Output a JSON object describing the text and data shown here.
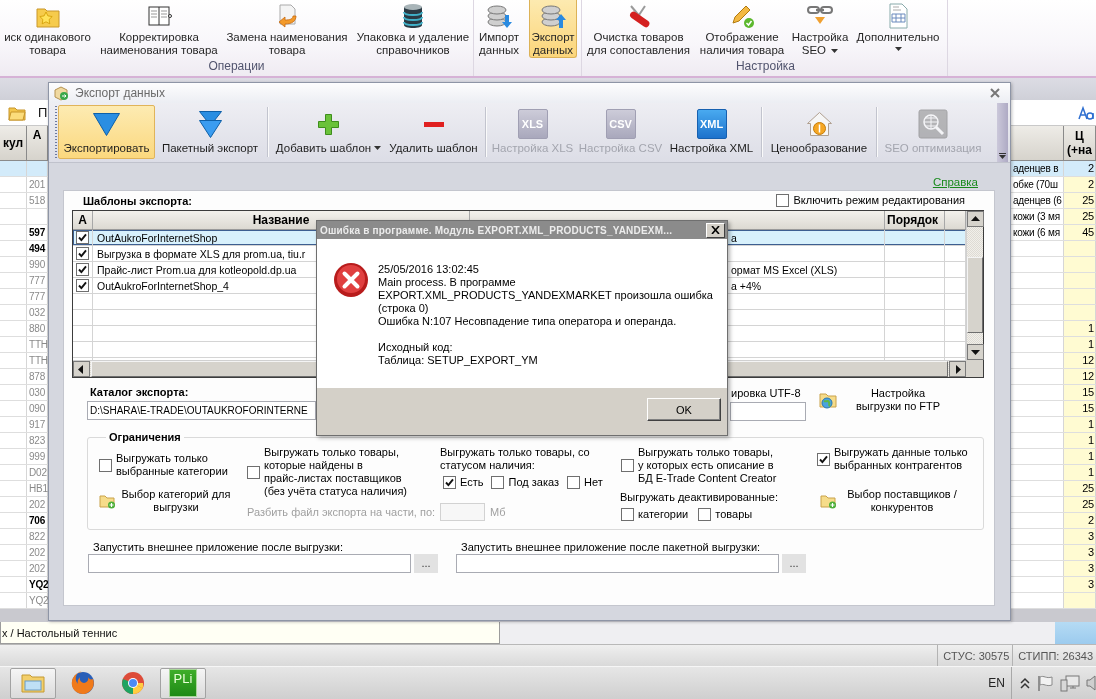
{
  "ribbon": {
    "groups": [
      {
        "label": "Операции",
        "buttons": [
          {
            "lines": [
              "иск одинакового",
              "товара"
            ],
            "selected": false,
            "dropdown": false
          },
          {
            "lines": [
              "Корректировка",
              "наименования товара"
            ],
            "selected": false,
            "dropdown": false
          },
          {
            "lines": [
              "Замена наименования",
              "товара"
            ],
            "selected": false,
            "dropdown": false
          },
          {
            "lines": [
              "Упаковка и удаление",
              "справочников"
            ],
            "selected": false,
            "dropdown": false
          }
        ]
      },
      {
        "buttons": [
          {
            "lines": [
              "Импорт",
              "данных"
            ],
            "selected": false,
            "dropdown": false
          },
          {
            "lines": [
              "Экспорт",
              "данных"
            ],
            "selected": true,
            "dropdown": false
          }
        ]
      },
      {
        "label": "Настройка",
        "buttons": [
          {
            "lines": [
              "Очистка товаров",
              "для сопоставления"
            ],
            "selected": false,
            "dropdown": false
          },
          {
            "lines": [
              "Отображение",
              "наличия товара"
            ],
            "selected": false,
            "dropdown": false
          },
          {
            "lines": [
              "Настройка",
              "SEO"
            ],
            "selected": false,
            "dropdown": true
          },
          {
            "lines": [
              "Дополнительно"
            ],
            "selected": false,
            "dropdown": true
          }
        ]
      }
    ]
  },
  "main": {
    "toolbar_label": "П",
    "left_table": {
      "column_1": "кул",
      "column_2": "А",
      "rows": [
        {
          "selected": true
        },
        {
          "selected": false,
          "dimmed": true,
          "column_2": "201"
        },
        {
          "selected": false,
          "dimmed": true,
          "column_2": "518"
        },
        {
          "selected": false
        },
        {
          "selected": false,
          "dimmed": false,
          "column_2": "597"
        },
        {
          "selected": false,
          "dimmed": false,
          "column_2": "494"
        },
        {
          "selected": false,
          "dimmed": true,
          "column_2": "990"
        },
        {
          "selected": false,
          "dimmed": true,
          "column_2": "777"
        },
        {
          "selected": false,
          "dimmed": true,
          "column_2": "777"
        },
        {
          "selected": false,
          "dimmed": true,
          "column_2": "032"
        },
        {
          "selected": false,
          "dimmed": true,
          "column_2": "880"
        },
        {
          "selected": false,
          "dimmed": true,
          "column_2": "TTH"
        },
        {
          "selected": false,
          "dimmed": true,
          "column_2": "TTH"
        },
        {
          "selected": false,
          "dimmed": true,
          "column_2": "878"
        },
        {
          "selected": false,
          "dimmed": true,
          "column_2": "030"
        },
        {
          "selected": false,
          "dimmed": true,
          "column_2": "090"
        },
        {
          "selected": false,
          "dimmed": true,
          "column_2": "917"
        },
        {
          "selected": false,
          "dimmed": true,
          "column_2": "823"
        },
        {
          "selected": false,
          "dimmed": true,
          "column_2": "999"
        },
        {
          "selected": false,
          "dimmed": true,
          "column_2": "D02"
        },
        {
          "selected": false,
          "dimmed": true,
          "column_2": "HB1"
        },
        {
          "selected": false,
          "dimmed": true,
          "column_2": "202"
        },
        {
          "selected": false,
          "dimmed": false,
          "column_2": "706"
        },
        {
          "selected": false,
          "dimmed": true,
          "column_2": "822"
        },
        {
          "selected": false,
          "dimmed": true,
          "column_2": "202"
        },
        {
          "selected": false,
          "dimmed": true,
          "column_2": "202"
        },
        {
          "selected": false,
          "dimmed": false,
          "column_2": "YQ2"
        },
        {
          "selected": false,
          "dimmed": true,
          "column_2": "YQ2"
        }
      ]
    },
    "right_table": {
      "column_2": [
        "Ц",
        "(+на"
      ],
      "rows": [
        {
          "selected": true,
          "column_1": "аденцев в",
          "column_2": "2"
        },
        {
          "selected": false,
          "column_1": "обке (70ш",
          "column_2": "2"
        },
        {
          "selected": false,
          "column_1": "аденцев (6",
          "column_2": "25"
        },
        {
          "selected": false,
          "column_1": "кожи (3 мя",
          "column_2": "25"
        },
        {
          "selected": false,
          "column_1": "кожи (6 мя",
          "column_2": "45"
        },
        {
          "selected": false
        },
        {
          "selected": false
        },
        {
          "selected": false
        },
        {
          "selected": false
        },
        {
          "selected": false
        },
        {
          "selected": false,
          "column_2": "1"
        },
        {
          "selected": false,
          "column_2": "1"
        },
        {
          "selected": false,
          "column_2": "12"
        },
        {
          "selected": false,
          "column_2": "12"
        },
        {
          "selected": false,
          "column_2": "15"
        },
        {
          "selected": false,
          "column_2": "15"
        },
        {
          "selected": false,
          "column_2": "1"
        },
        {
          "selected": false,
          "column_2": "1"
        },
        {
          "selected": false,
          "column_2": "1"
        },
        {
          "selected": false,
          "column_2": "1"
        },
        {
          "selected": false,
          "column_2": "25"
        },
        {
          "selected": false,
          "column_2": "25"
        },
        {
          "selected": false,
          "column_2": "2"
        },
        {
          "selected": false,
          "column_2": "3"
        },
        {
          "selected": false,
          "column_2": "3"
        },
        {
          "selected": false,
          "column_2": "3"
        },
        {
          "selected": false,
          "column_2": "3"
        },
        {
          "selected": false
        }
      ]
    },
    "info_text": "х / Настольный теннис",
    "status": [
      "СТУС: 30575",
      "СТИПП: 26343"
    ]
  },
  "export_window": {
    "title": "Экспорт данных",
    "toolbar": [
      {
        "buttons": [
          {
            "label": "Экспортировать",
            "selected": true,
            "disabled": false,
            "dropdown": false
          },
          {
            "label": "Пакетный экспорт",
            "selected": false,
            "disabled": false,
            "dropdown": false
          }
        ]
      },
      {
        "buttons": [
          {
            "label": "Добавить шаблон",
            "selected": false,
            "disabled": false,
            "dropdown": true
          },
          {
            "label": "Удалить шаблон",
            "selected": false,
            "disabled": false,
            "dropdown": false
          }
        ]
      },
      {
        "buttons": [
          {
            "label": "Настройка XLS",
            "badge": "XLS",
            "selected": false,
            "disabled": true,
            "dropdown": false
          },
          {
            "label": "Настройка CSV",
            "badge": "CSV",
            "selected": false,
            "disabled": true,
            "dropdown": false
          },
          {
            "label": "Настройка XML",
            "badge": "XML",
            "selected": false,
            "disabled": false,
            "dropdown": false
          }
        ]
      },
      {
        "buttons": [
          {
            "label": "Ценообразование",
            "selected": false,
            "disabled": false,
            "dropdown": false
          }
        ]
      },
      {
        "buttons": [
          {
            "label": "SEO оптимизация",
            "selected": false,
            "disabled": true,
            "dropdown": false
          }
        ]
      }
    ],
    "help_link": "Справка",
    "templates": {
      "title": "Шаблоны экспорта:",
      "edit_mode": {
        "label": "Включить режим редактирования",
        "checked": false
      },
      "columns": [
        "А",
        "Название",
        "Порядок"
      ],
      "rows": [
        {
          "checked": true,
          "selected": true,
          "name": "OutAukroForInternetShop",
          "column_3": "а"
        },
        {
          "checked": true,
          "selected": false,
          "name": "Выгрузка в формате XLS для prom.ua, tiu.r"
        },
        {
          "checked": true,
          "selected": false,
          "name": "Прайс-лист Prom.ua для kotleopold.dp.ua",
          "column_3": "ормат MS Excel (XLS)"
        },
        {
          "checked": true,
          "selected": false,
          "name": "OutAukroForInternetShop_4",
          "column_3": "а +4%"
        }
      ]
    },
    "catalog": {
      "label": "Каталог экспорта:",
      "value": "D:\\SHARA\\E-TRADE\\OUTAUKROFORINTERNE"
    },
    "encoding_label": "ировка UTF-8",
    "ftp_button": [
      "Настройка",
      "выгрузки по FTP"
    ],
    "restrictions": {
      "title": "Ограничения",
      "categories_only": {
        "lines": [
          "Выгружать только",
          "выбранные категории"
        ],
        "checked": false
      },
      "choose_categories": [
        "Выбор категорий для",
        "выгрузки"
      ],
      "supplier_prices_only": {
        "lines": [
          "Выгружать только товары,",
          "которые найдены в",
          "прайс-листах поставщиков",
          "(без учёта статуса наличия)"
        ],
        "checked": false
      },
      "split": {
        "label": "Разбить файл экспорта на части, по:",
        "unit": "Мб",
        "disabled": true
      },
      "stock_status": {
        "lines": [
          "Выгружать только товары, со",
          "статусом наличия:"
        ],
        "options": [
          {
            "label": "Есть",
            "checked": true
          },
          {
            "label": "Под заказ",
            "checked": false
          },
          {
            "label": "Нет",
            "checked": false
          }
        ]
      },
      "with_description": {
        "lines": [
          "Выгружать только товары,",
          "у которых есть описание в",
          "БД E-Trade Content Creator"
        ],
        "checked": false
      },
      "deactivated": {
        "label": "Выгружать деактивированные:",
        "options": [
          {
            "label": "категории",
            "checked": false
          },
          {
            "label": "товары",
            "checked": false
          }
        ]
      },
      "selected_contractors": {
        "lines": [
          "Выгружать данные только",
          "выбранных контрагентов"
        ],
        "checked": true
      },
      "choose_suppliers": [
        "Выбор поставщиков /",
        "конкурентов"
      ]
    },
    "run_after": [
      {
        "label": "Запустить внешнее приложение после выгрузки:",
        "button": "..."
      },
      {
        "label": "Запустить внешнее приложение после пакетной выгрузки:",
        "button": "..."
      }
    ]
  },
  "error_dialog": {
    "title": "Ошибка в программе. Модуль EXPORT.XML_PRODUCTS_YANDEXM...",
    "message": [
      "25/05/2016 13:02:45",
      "Main process. В программе",
      "EXPORT.XML_PRODUCTS_YANDEXMARKET произошла ошибка",
      "(строка 0)",
      "Ошибка N:107 Несовпадение типа оператора и операнда."
    ],
    "source": [
      "Исходный код:",
      "Таблица: SETUP_EXPORT_YM"
    ],
    "button": "OK"
  },
  "taskbar": {
    "apps": [
      {
        "running": true
      },
      {
        "running": false
      },
      {
        "running": false
      },
      {
        "running": true,
        "logo_text": "PLi"
      }
    ],
    "language": "EN"
  }
}
